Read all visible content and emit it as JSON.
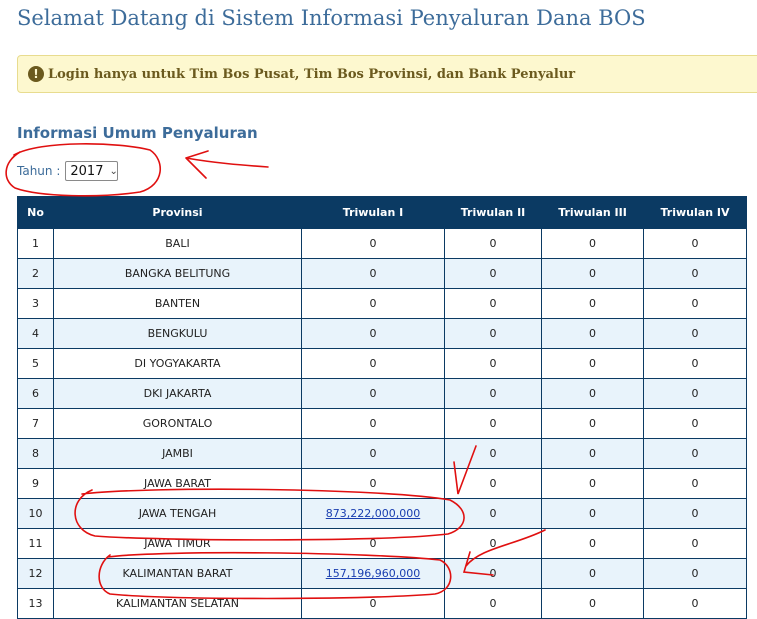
{
  "header": {
    "title": "Selamat Datang di Sistem Informasi Penyaluran Dana BOS"
  },
  "alert": {
    "icon": "exclamation-circle-icon",
    "message": "Login hanya untuk Tim Bos Pusat, Tim Bos Provinsi, dan Bank Penyalur"
  },
  "section": {
    "title": "Informasi Umum Penyaluran"
  },
  "filter": {
    "label": "Tahun :",
    "selected_year": "2017"
  },
  "table": {
    "columns": [
      "No",
      "Provinsi",
      "Triwulan I",
      "Triwulan II",
      "Triwulan III",
      "Triwulan IV"
    ],
    "rows": [
      {
        "no": "1",
        "provinsi": "BALI",
        "t1": "0",
        "t2": "0",
        "t3": "0",
        "t4": "0"
      },
      {
        "no": "2",
        "provinsi": "BANGKA BELITUNG",
        "t1": "0",
        "t2": "0",
        "t3": "0",
        "t4": "0"
      },
      {
        "no": "3",
        "provinsi": "BANTEN",
        "t1": "0",
        "t2": "0",
        "t3": "0",
        "t4": "0"
      },
      {
        "no": "4",
        "provinsi": "BENGKULU",
        "t1": "0",
        "t2": "0",
        "t3": "0",
        "t4": "0"
      },
      {
        "no": "5",
        "provinsi": "DI YOGYAKARTA",
        "t1": "0",
        "t2": "0",
        "t3": "0",
        "t4": "0"
      },
      {
        "no": "6",
        "provinsi": "DKI JAKARTA",
        "t1": "0",
        "t2": "0",
        "t3": "0",
        "t4": "0"
      },
      {
        "no": "7",
        "provinsi": "GORONTALO",
        "t1": "0",
        "t2": "0",
        "t3": "0",
        "t4": "0"
      },
      {
        "no": "8",
        "provinsi": "JAMBI",
        "t1": "0",
        "t2": "0",
        "t3": "0",
        "t4": "0"
      },
      {
        "no": "9",
        "provinsi": "JAWA BARAT",
        "t1": "0",
        "t2": "0",
        "t3": "0",
        "t4": "0"
      },
      {
        "no": "10",
        "provinsi": "JAWA TENGAH",
        "t1": "873,222,000,000",
        "t2": "0",
        "t3": "0",
        "t4": "0"
      },
      {
        "no": "11",
        "provinsi": "JAWA TIMUR",
        "t1": "0",
        "t2": "0",
        "t3": "0",
        "t4": "0"
      },
      {
        "no": "12",
        "provinsi": "KALIMANTAN BARAT",
        "t1": "157,196,960,000",
        "t2": "0",
        "t3": "0",
        "t4": "0"
      },
      {
        "no": "13",
        "provinsi": "KALIMANTAN SELATAN",
        "t1": "0",
        "t2": "0",
        "t3": "0",
        "t4": "0"
      }
    ]
  },
  "colors": {
    "title": "#3d6c9a",
    "header_bg": "#0b3a63",
    "alert_bg": "#fdf8cf",
    "row_alt": "#e8f3fb",
    "link": "#1a3fb0",
    "annotation": "#e01010"
  }
}
